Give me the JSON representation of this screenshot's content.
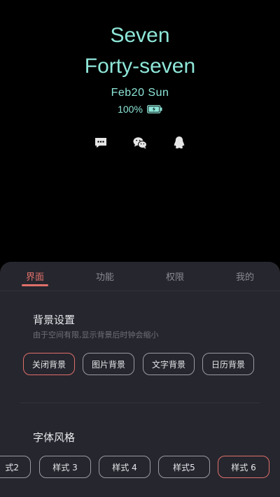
{
  "clock": {
    "hour_text": "Seven",
    "minute_text": "Forty-seven",
    "date_text": "Feb20 Sun",
    "battery_text": "100%",
    "accent_color": "#8ee6d8",
    "battery_level": 1.0,
    "notification_icons": [
      "sms-icon",
      "wechat-icon",
      "qq-icon"
    ]
  },
  "tabs": [
    {
      "label": "界面",
      "active": true
    },
    {
      "label": "功能",
      "active": false
    },
    {
      "label": "权限",
      "active": false
    },
    {
      "label": "我的",
      "active": false
    }
  ],
  "background_settings": {
    "title": "背景设置",
    "subtitle": "由于空间有限,显示背景后时钟会缩小",
    "options": [
      {
        "label": "关闭背景",
        "selected": true
      },
      {
        "label": "图片背景",
        "selected": false
      },
      {
        "label": "文字背景",
        "selected": false
      },
      {
        "label": "日历背景",
        "selected": false
      }
    ]
  },
  "font_style": {
    "title": "字体风格",
    "options": [
      {
        "label": "式2",
        "selected": false
      },
      {
        "label": "样式 3",
        "selected": false
      },
      {
        "label": "样式 4",
        "selected": false
      },
      {
        "label": "样式5",
        "selected": false
      },
      {
        "label": "样式 6",
        "selected": true
      }
    ]
  },
  "colors": {
    "accent_red": "#e0706a",
    "sheet_bg": "#26262e"
  }
}
